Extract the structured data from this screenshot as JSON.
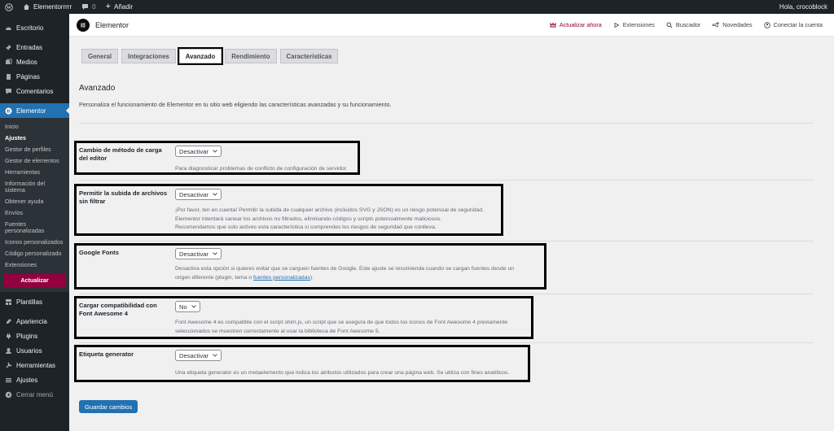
{
  "adminbar": {
    "site_name": "Elementorrrrr",
    "comments_count": "0",
    "add_new": "Añadir",
    "greeting": "Hola, crocoblock"
  },
  "sidebar": {
    "items_top": [
      {
        "label": "Escritorio",
        "icon": "dashboard-icon"
      },
      {
        "label": "Entradas",
        "icon": "pin-icon"
      },
      {
        "label": "Medios",
        "icon": "media-icon"
      },
      {
        "label": "Páginas",
        "icon": "pages-icon"
      },
      {
        "label": "Comentarios",
        "icon": "comments-icon"
      }
    ],
    "elementor_label": "Elementor",
    "submenu": [
      "Inicio",
      "Ajustes",
      "Gestor de perfiles",
      "Gestor de elementos",
      "Herramientas",
      "Información del sistema",
      "Obtener ayuda",
      "Envíos",
      "Fuentes personalizadas",
      "Iconos personalizados",
      "Código personalizado",
      "Extensiones"
    ],
    "upgrade_label": "Actualizar",
    "items_bottom": [
      {
        "label": "Plantillas",
        "icon": "templates-icon"
      },
      {
        "label": "Apariencia",
        "icon": "appearance-icon"
      },
      {
        "label": "Plugins",
        "icon": "plugins-icon"
      },
      {
        "label": "Usuarios",
        "icon": "users-icon"
      },
      {
        "label": "Herramientas",
        "icon": "tools-icon"
      },
      {
        "label": "Ajustes",
        "icon": "settings-icon"
      },
      {
        "label": "Cerrar menú",
        "icon": "collapse-icon"
      }
    ]
  },
  "header": {
    "title": "Elementor",
    "links": {
      "upgrade": "Actualizar ahora",
      "extensions": "Extensiones",
      "search": "Buscador",
      "whatsnew": "Novedades",
      "connect": "Conectar la cuenta"
    }
  },
  "tabs": [
    "General",
    "Integraciones",
    "Avanzado",
    "Rendimiento",
    "Características"
  ],
  "section": {
    "title": "Avanzado",
    "description": "Personaliza el funcionamiento de Elementor en tu sitio web eligiendo las características avanzadas y su funcionamiento."
  },
  "settings": {
    "editor_loader": {
      "label": "Cambio de método de carga del editor",
      "value": "Desactivar",
      "description": "Para diagnosticar problemas de conflicto de configuración de servidor."
    },
    "unfiltered_uploads": {
      "label": "Permitir la subida de archivos sin filtrar",
      "value": "Desactivar",
      "desc_line1": "¡Por favor, ten en cuenta! Permitir la subida de cualquier archivo (incluidos SVG y JSON) es un riesgo potencial de seguridad.",
      "desc_line2": "Elementor intentará sanear los archivos no filtrados, eliminando códigos y scripts potencialmente maliciosos.",
      "desc_line3": "Recomendamos que solo actives esta característica si comprendes los riesgos de seguridad que conlleva."
    },
    "google_fonts": {
      "label": "Google Fonts",
      "value": "Desactivar",
      "desc_line1": "Desactiva esta opción si quieres evitar que se carguen fuentes de Google. Este ajuste se recomienda cuando se cargan fuentes desde un",
      "desc_line2_pre": "origen diferente (plugin, tema o ",
      "desc_link": "fuentes personalizadas",
      "desc_line2_post": ")."
    },
    "font_awesome": {
      "label": "Cargar compatibilidad con Font Awesome 4",
      "value": "No",
      "desc_line1": "Font Awesome 4 es compatible con el script shim.js, un script que se asegura de que todos los iconos de Font Awesome 4 previamente",
      "desc_line2": "seleccionados se muestren correctamente al usar la biblioteca de Font Awesome 5."
    },
    "generator_tag": {
      "label": "Etiqueta generator",
      "value": "Desactivar",
      "description": "Una etiqueta generator es un metaelemento que indica los atributos utilizados para crear una página web. Se utiliza con fines analíticos."
    }
  },
  "save_label": "Guardar cambios",
  "colors": {
    "admin_dark": "#1d2327",
    "active_blue": "#2271b1",
    "elementor_accent": "#93003f"
  }
}
